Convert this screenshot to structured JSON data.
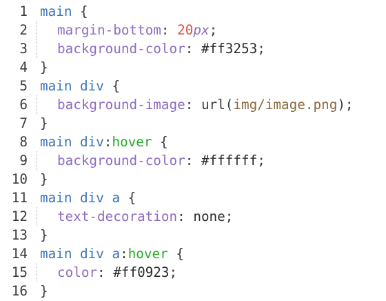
{
  "editor": {
    "lines": [
      {
        "num": "1",
        "sel": "main",
        "open": " {"
      },
      {
        "num": "2",
        "prop": "margin-bottom",
        "colon": ": ",
        "num_val": "20",
        "unit": "px",
        "semi": ";"
      },
      {
        "num": "3",
        "prop": "background-color",
        "colon": ": ",
        "val": "#ff3253",
        "semi": ";"
      },
      {
        "num": "4",
        "close": "}"
      },
      {
        "num": "5",
        "sel": "main div",
        "open": " {"
      },
      {
        "num": "6",
        "prop": "background-image",
        "colon": ": ",
        "func": "url",
        "paren_open": "(",
        "str": "img/image.png",
        "paren_close": ")",
        "semi": ";"
      },
      {
        "num": "7",
        "close": "}"
      },
      {
        "num": "8",
        "sel": "main div",
        "pseudo_colon": ":",
        "pseudo": "hover",
        "open": " {"
      },
      {
        "num": "9",
        "prop": "background-color",
        "colon": ": ",
        "val": "#ffffff",
        "semi": ";"
      },
      {
        "num": "10",
        "close": "}"
      },
      {
        "num": "11",
        "sel": "main div a",
        "open": " {"
      },
      {
        "num": "12",
        "prop": "text-decoration",
        "colon": ": ",
        "val": "none",
        "semi": ";"
      },
      {
        "num": "13",
        "close": "}"
      },
      {
        "num": "14",
        "sel": "main div a",
        "pseudo_colon": ":",
        "pseudo": "hover",
        "open": " {"
      },
      {
        "num": "15",
        "prop": "color",
        "colon": ": ",
        "val": "#ff0923",
        "semi": ";"
      },
      {
        "num": "16",
        "close": "}"
      }
    ]
  },
  "colors": {
    "selector": "#3a73b8",
    "pseudo": "#2aa82a",
    "property": "#8d6cc2",
    "number": "#e0503a",
    "string": "#8c6a3e"
  }
}
